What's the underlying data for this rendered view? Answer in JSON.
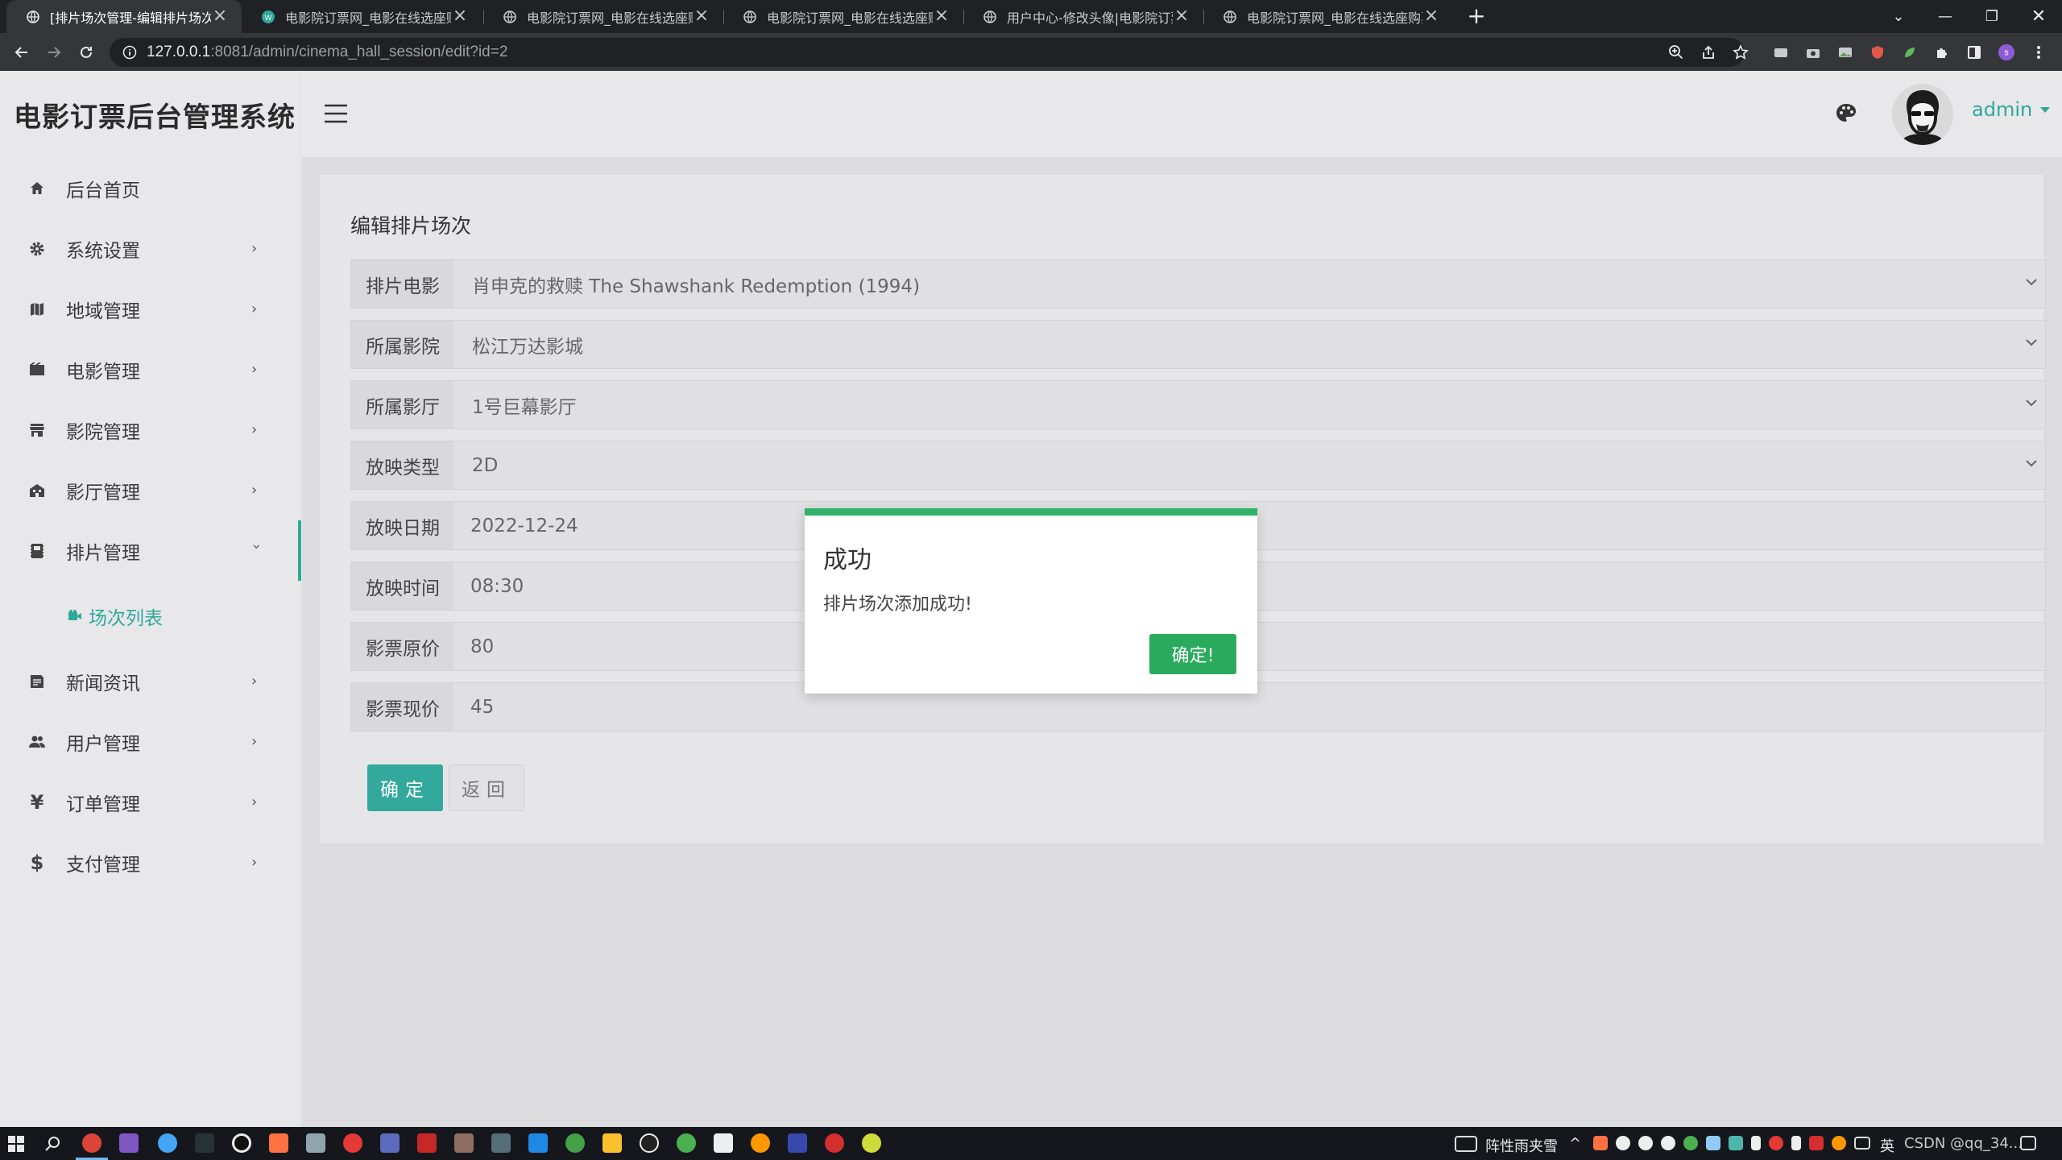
{
  "browser": {
    "tabs": [
      {
        "label": "[排片场次管理-编辑排片场次",
        "active": true
      },
      {
        "label": "电影院订票网_电影在线选座购票"
      },
      {
        "label": "电影院订票网_电影在线选座购票"
      },
      {
        "label": "电影院订票网_电影在线选座购票"
      },
      {
        "label": "用户中心-修改头像|电影院订票网"
      },
      {
        "label": "电影院订票网_电影在线选座购票"
      }
    ],
    "url_host": "127.0.0.1",
    "url_rest": ":8081/admin/cinema_hall_session/edit?id=2"
  },
  "app": {
    "brand": "电影订票后台管理系统",
    "user": "admin"
  },
  "sidebar": {
    "items": [
      {
        "label": "后台首页",
        "icon": "home-icon"
      },
      {
        "label": "系统设置",
        "icon": "gear-icon"
      },
      {
        "label": "地域管理",
        "icon": "map-icon"
      },
      {
        "label": "电影管理",
        "icon": "film-icon"
      },
      {
        "label": "影院管理",
        "icon": "store-icon"
      },
      {
        "label": "影厅管理",
        "icon": "building-icon"
      },
      {
        "label": "排片管理",
        "icon": "schedule-icon"
      },
      {
        "label": "新闻资讯",
        "icon": "news-icon"
      },
      {
        "label": "用户管理",
        "icon": "users-icon"
      },
      {
        "label": "订单管理",
        "icon": "yen-icon"
      },
      {
        "label": "支付管理",
        "icon": "dollar-icon"
      }
    ],
    "sub_item": "场次列表"
  },
  "form": {
    "title": "编辑排片场次",
    "fields": [
      {
        "label": "排片电影",
        "value": "肖申克的救赎 The Shawshank Redemption (1994)"
      },
      {
        "label": "所属影院",
        "value": "松江万达影城"
      },
      {
        "label": "所属影厅",
        "value": "1号巨幕影厅"
      },
      {
        "label": "放映类型",
        "value": "2D"
      },
      {
        "label": "放映日期",
        "value": "2022-12-24"
      },
      {
        "label": "放映时间",
        "value": "08:30"
      },
      {
        "label": "影票原价",
        "value": "80"
      },
      {
        "label": "影票现价",
        "value": "45"
      }
    ],
    "submit": "确定",
    "back": "返回"
  },
  "modal": {
    "title": "成功",
    "message": "排片场次添加成功!",
    "ok": "确定!"
  },
  "taskbar": {
    "weather": "阵性雨夹雪",
    "ime": "英",
    "watermark": "CSDN @qq_34..."
  },
  "colors": {
    "accent": "#2fa89a",
    "success": "#2fb26a",
    "ok_button": "#2aaa5c"
  }
}
